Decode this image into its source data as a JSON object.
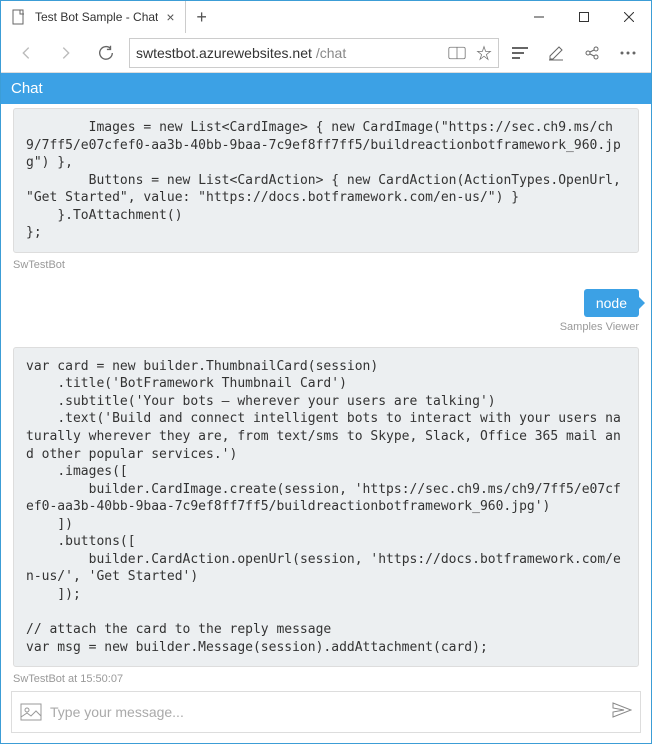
{
  "window": {
    "tab_title": "Test Bot Sample - Chat"
  },
  "address": {
    "host": "swtestbot.azurewebsites.net",
    "path": "/chat"
  },
  "chat": {
    "header_title": "Chat",
    "messages": [
      {
        "from": "bot",
        "text": "        Images = new List<CardImage> { new CardImage(\"https://sec.ch9.ms/ch9/7ff5/e07cfef0-aa3b-40bb-9baa-7c9ef8ff7ff5/buildreactionbotframework_960.jpg\") },\n        Buttons = new List<CardAction> { new CardAction(ActionTypes.OpenUrl, \"Get Started\", value: \"https://docs.botframework.com/en-us/\") }\n    }.ToAttachment()\n};",
        "meta": "SwTestBot"
      },
      {
        "from": "user",
        "text": "node",
        "meta": "Samples Viewer"
      },
      {
        "from": "bot",
        "text": "var card = new builder.ThumbnailCard(session)\n    .title('BotFramework Thumbnail Card')\n    .subtitle('Your bots — wherever your users are talking')\n    .text('Build and connect intelligent bots to interact with your users naturally wherever they are, from text/sms to Skype, Slack, Office 365 mail and other popular services.')\n    .images([\n        builder.CardImage.create(session, 'https://sec.ch9.ms/ch9/7ff5/e07cfef0-aa3b-40bb-9baa-7c9ef8ff7ff5/buildreactionbotframework_960.jpg')\n    ])\n    .buttons([\n        builder.CardAction.openUrl(session, 'https://docs.botframework.com/en-us/', 'Get Started')\n    ]);\n\n// attach the card to the reply message\nvar msg = new builder.Message(session).addAttachment(card);",
        "meta": "SwTestBot at 15:50:07"
      }
    ],
    "composer_placeholder": "Type your message..."
  }
}
